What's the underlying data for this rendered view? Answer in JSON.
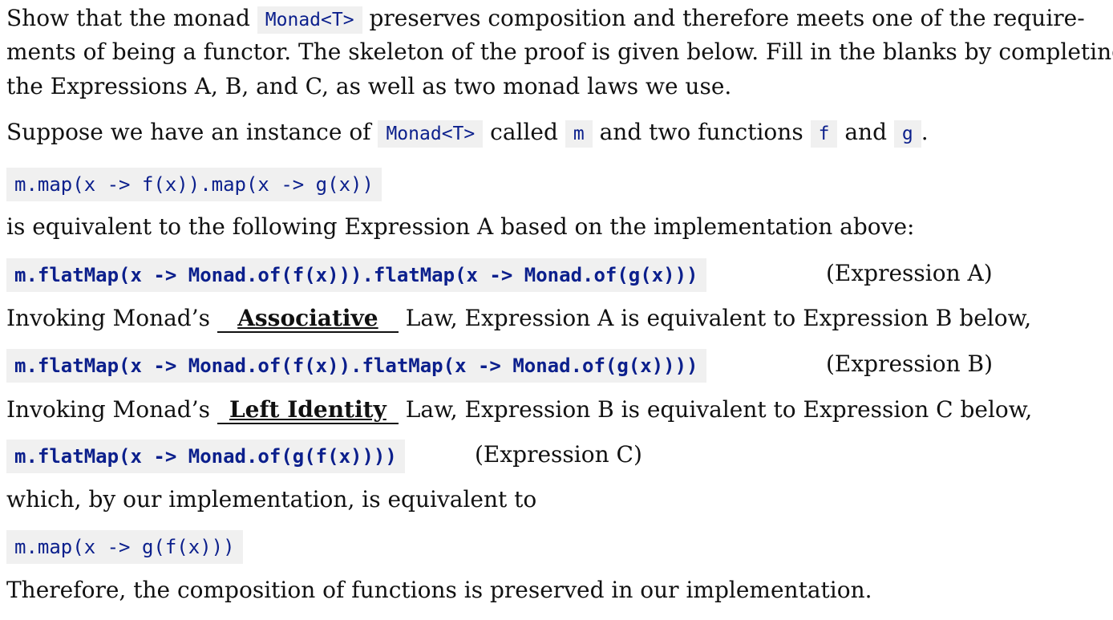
{
  "intro": {
    "part1": "Show that the monad ",
    "code1": "Monad<T>",
    "part2": " preserves composition and therefore meets one of the require-",
    "line2": "ments of being a functor.  The skeleton of the proof is given below. Fill in the blanks by completing",
    "line3": "the Expressions A, B, and C, as well as two monad laws we use."
  },
  "suppose": {
    "part1": "Suppose we have an instance of ",
    "code1": "Monad<T>",
    "part2": " called ",
    "code2": "m",
    "part3": " and two functions ",
    "code3": "f",
    "part4": " and ",
    "code4": "g",
    "part5": "."
  },
  "code_start": "m.map(x -> f(x)).map(x -> g(x))",
  "equiv_text": "is equivalent to the following Expression A based on the implementation above:",
  "expr_a": {
    "code": "m.flatMap(x -> Monad.of(f(x))).flatMap(x -> Monad.of(g(x)))",
    "label": "(Expression A)"
  },
  "invoke1": {
    "prefix": "Invoking Monad’s ",
    "blank": "Associative",
    "suffix": " Law, Expression A is equivalent to Expression B below,"
  },
  "expr_b": {
    "code": "m.flatMap(x -> Monad.of(f(x)).flatMap(x -> Monad.of(g(x))))",
    "label": "(Expression B)"
  },
  "invoke2": {
    "prefix": "Invoking Monad’s ",
    "blank": "Left Identity",
    "suffix": " Law, Expression B is equivalent to Expression C below,"
  },
  "expr_c": {
    "code": "m.flatMap(x -> Monad.of(g(f(x))))",
    "label": "(Expression C)"
  },
  "which_text": "which, by our implementation, is equivalent to",
  "code_end": "m.map(x -> g(f(x)))",
  "conclusion": "Therefore, the composition of functions is preserved in our implementation."
}
